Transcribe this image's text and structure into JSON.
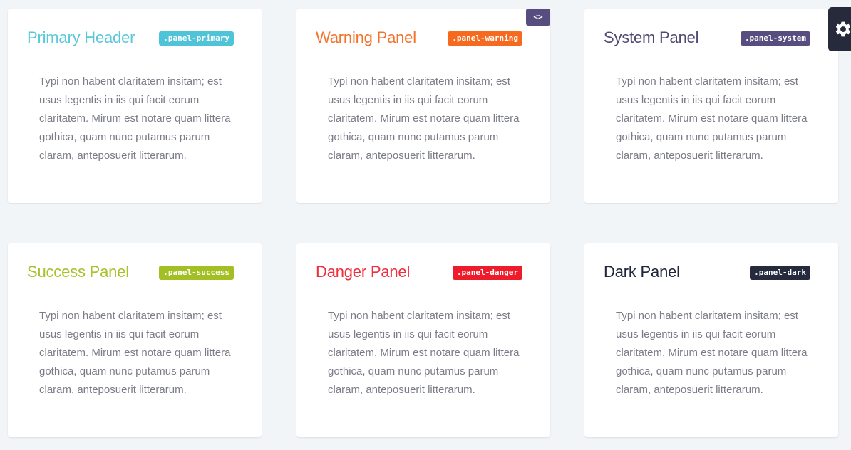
{
  "code_toggle": {
    "label": "<>"
  },
  "settings": {
    "icon": "gear-icon"
  },
  "panels": [
    {
      "title": "Primary Header",
      "badge": ".panel-primary",
      "color": "#5bc8da",
      "badge_color": "#4fc4d8",
      "body": "Typi non habent claritatem insitam; est usus legentis in iis qui facit eorum claritatem. Mirum est notare quam littera gothica, quam nunc putamus parum claram, anteposuerit litterarum."
    },
    {
      "title": "Warning Panel",
      "badge": ".panel-warning",
      "color": "#f3722c",
      "badge_color": "#f56a1e",
      "body": "Typi non habent claritatem insitam; est usus legentis in iis qui facit eorum claritatem. Mirum est notare quam littera gothica, quam nunc putamus parum claram, anteposuerit litterarum."
    },
    {
      "title": "System Panel",
      "badge": ".panel-system",
      "color": "#4e4a73",
      "badge_color": "#574e7f",
      "body": "Typi non habent claritatem insitam; est usus legentis in iis qui facit eorum claritatem. Mirum est notare quam littera gothica, quam nunc putamus parum claram, anteposuerit litterarum."
    },
    {
      "title": "Success Panel",
      "badge": ".panel-success",
      "color": "#a7c22a",
      "badge_color": "#a3bf23",
      "body": "Typi non habent claritatem insitam; est usus legentis in iis qui facit eorum claritatem. Mirum est notare quam littera gothica, quam nunc putamus parum claram, anteposuerit litterarum."
    },
    {
      "title": "Danger Panel",
      "badge": ".panel-danger",
      "color": "#ef2f3d",
      "badge_color": "#ee1c2b",
      "body": "Typi non habent claritatem insitam; est usus legentis in iis qui facit eorum claritatem. Mirum est notare quam littera gothica, quam nunc putamus parum claram, anteposuerit litterarum."
    },
    {
      "title": "Dark Panel",
      "badge": ".panel-dark",
      "color": "#22263a",
      "badge_color": "#262a3d",
      "body": "Typi non habent claritatem insitam; est usus legentis in iis qui facit eorum claritatem. Mirum est notare quam littera gothica, quam nunc putamus parum claram, anteposuerit litterarum."
    }
  ]
}
